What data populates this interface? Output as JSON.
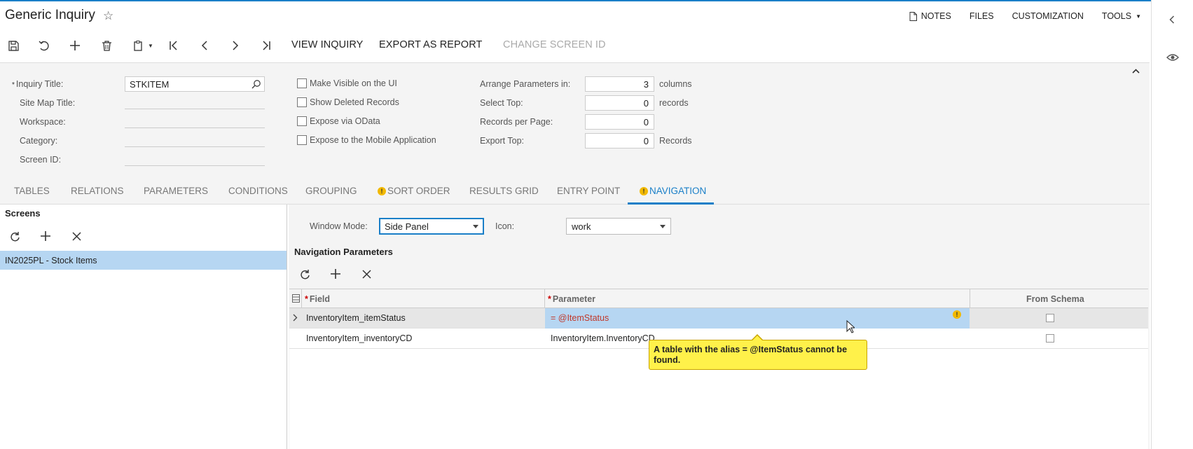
{
  "header": {
    "title": "Generic Inquiry",
    "links": {
      "notes": "NOTES",
      "files": "FILES",
      "customization": "CUSTOMIZATION",
      "tools": "TOOLS"
    }
  },
  "toolbar": {
    "view_inquiry": "VIEW INQUIRY",
    "export_as_report": "EXPORT AS REPORT",
    "change_screen_id": "CHANGE SCREEN ID"
  },
  "form": {
    "inquiry_title_label": "Inquiry Title:",
    "inquiry_title_value": "STKITEM",
    "site_map_title_label": "Site Map Title:",
    "workspace_label": "Workspace:",
    "category_label": "Category:",
    "screen_id_label": "Screen ID:",
    "make_visible": "Make Visible on the UI",
    "show_deleted": "Show Deleted Records",
    "expose_odata": "Expose via OData",
    "expose_mobile": "Expose to the Mobile Application",
    "arrange_label": "Arrange Parameters in:",
    "arrange_value": "3",
    "arrange_unit": "columns",
    "select_top_label": "Select Top:",
    "select_top_value": "0",
    "select_top_unit": "records",
    "records_per_page_label": "Records per Page:",
    "records_per_page_value": "0",
    "export_top_label": "Export Top:",
    "export_top_value": "0",
    "export_top_unit": "Records"
  },
  "tabs": {
    "tables": "TABLES",
    "relations": "RELATIONS",
    "parameters": "PARAMETERS",
    "conditions": "CONDITIONS",
    "grouping": "GROUPING",
    "sort_order": "SORT ORDER",
    "results_grid": "RESULTS GRID",
    "entry_point": "ENTRY POINT",
    "navigation": "NAVIGATION"
  },
  "screens": {
    "title": "Screens",
    "items": [
      {
        "label": "IN2025PL - Stock Items"
      }
    ]
  },
  "navigation": {
    "window_mode_label": "Window Mode:",
    "window_mode_value": "Side Panel",
    "icon_label": "Icon:",
    "icon_value": "work",
    "params_title": "Navigation Parameters",
    "columns": {
      "field": "Field",
      "parameter": "Parameter",
      "from_schema": "From Schema"
    },
    "rows": [
      {
        "field": "InventoryItem_itemStatus",
        "parameter": "= @ItemStatus"
      },
      {
        "field": "InventoryItem_inventoryCD",
        "parameter": "InventoryItem.InventoryCD"
      }
    ],
    "tooltip": "A table with the alias = @ItemStatus cannot be found."
  },
  "colors": {
    "accent": "#1a7fc8",
    "selection": "#b6d6f2",
    "warning": "#f2b900",
    "tooltip_bg": "#fff14a",
    "error_text": "#c0392b"
  }
}
